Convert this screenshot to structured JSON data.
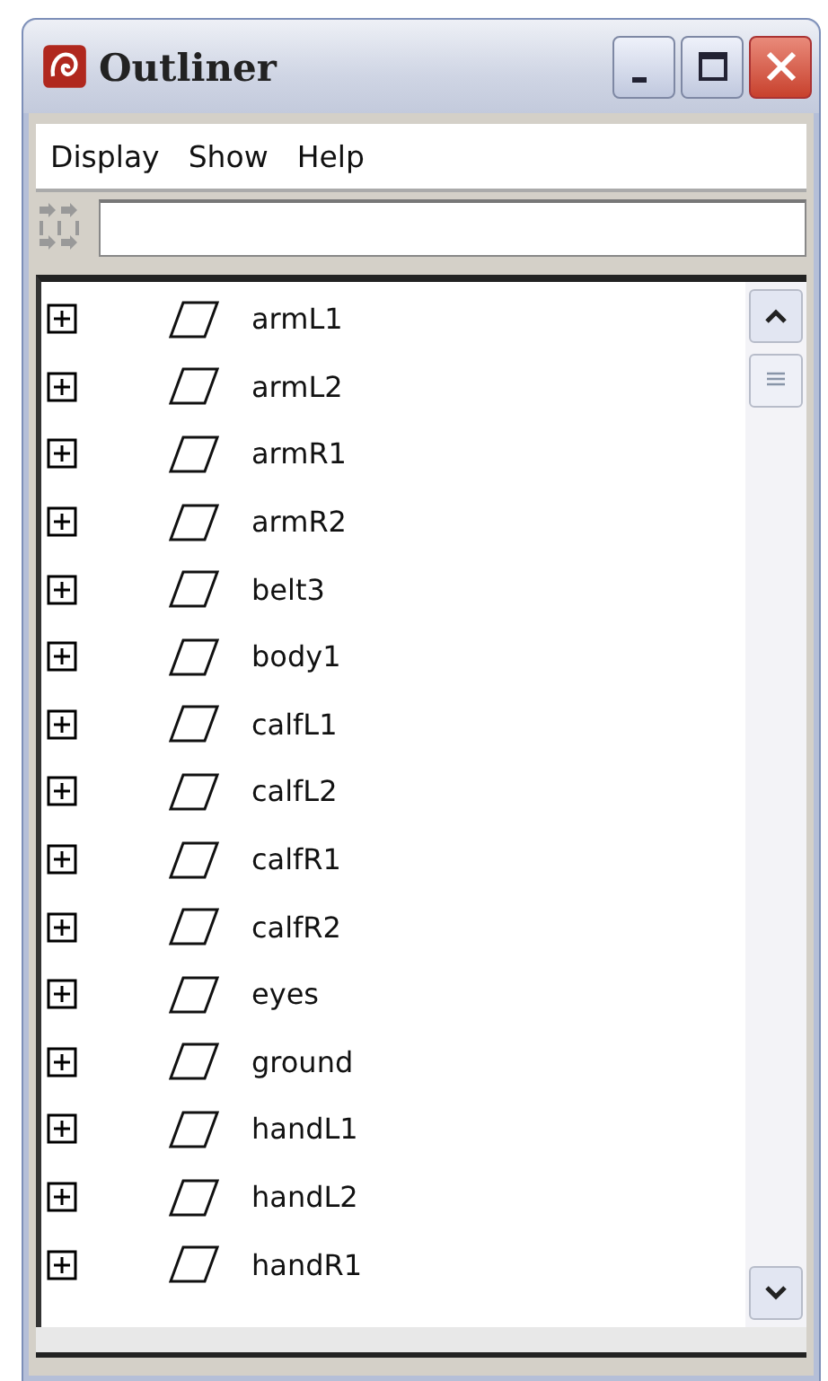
{
  "window": {
    "title": "Outliner"
  },
  "menu": [
    "Display",
    "Show",
    "Help"
  ],
  "items": [
    {
      "name": "armL1",
      "expanded": false
    },
    {
      "name": "armL2",
      "expanded": false
    },
    {
      "name": "armR1",
      "expanded": false
    },
    {
      "name": "armR2",
      "expanded": false
    },
    {
      "name": "belt3",
      "expanded": false
    },
    {
      "name": "body1",
      "expanded": false
    },
    {
      "name": "calfL1",
      "expanded": false
    },
    {
      "name": "calfL2",
      "expanded": false
    },
    {
      "name": "calfR1",
      "expanded": false
    },
    {
      "name": "calfR2",
      "expanded": false
    },
    {
      "name": "eyes",
      "expanded": false
    },
    {
      "name": "ground",
      "expanded": false
    },
    {
      "name": "handL1",
      "expanded": false
    },
    {
      "name": "handL2",
      "expanded": false
    },
    {
      "name": "handR1",
      "expanded": false
    }
  ]
}
